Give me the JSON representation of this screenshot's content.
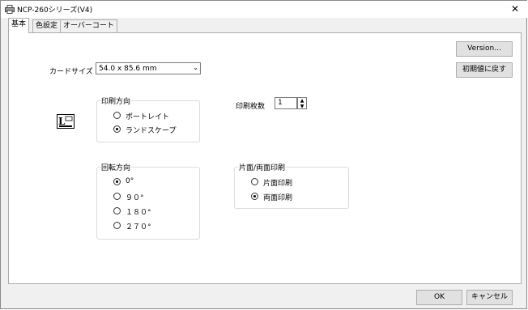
{
  "window": {
    "title": "NCP-260シリーズ(V4)",
    "close_glyph": "✕"
  },
  "tabs": [
    {
      "label": "基本",
      "active": true
    },
    {
      "label": "色設定",
      "active": false
    },
    {
      "label": "オーバーコート",
      "active": false
    }
  ],
  "buttons": {
    "version": "Version...",
    "reset": "初期値に戻す",
    "ok": "OK",
    "cancel": "キャンセル"
  },
  "card_size": {
    "label": "カードサイズ",
    "value": "54.0 x 85.6 mm"
  },
  "orientation": {
    "title": "印刷方向",
    "options": [
      {
        "label": "ポートレイト",
        "checked": false
      },
      {
        "label": "ランドスケープ",
        "checked": true
      }
    ],
    "icon": "landscape-orientation-icon"
  },
  "copies": {
    "label": "印刷枚数",
    "value": "1"
  },
  "rotation": {
    "title": "回転方向",
    "options": [
      {
        "label": "0°",
        "checked": true
      },
      {
        "label": "９０°",
        "checked": false
      },
      {
        "label": "１８０°",
        "checked": false
      },
      {
        "label": "２７０°",
        "checked": false
      }
    ]
  },
  "duplex": {
    "title": "片面/両面印刷",
    "options": [
      {
        "label": "片面印刷",
        "checked": false
      },
      {
        "label": "両面印刷",
        "checked": true
      }
    ]
  }
}
